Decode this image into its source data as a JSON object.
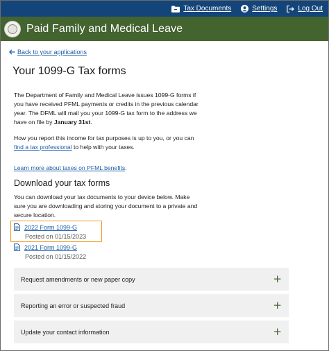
{
  "topbar": {
    "tax_documents": "Tax Documents",
    "settings": "Settings",
    "log_out": "Log Out",
    "background": "#14457a"
  },
  "brand": {
    "title": "Paid Family and Medical Leave",
    "background": "#43632f"
  },
  "nav": {
    "back": "Back to your applications"
  },
  "page": {
    "title": "Your 1099-G Tax forms",
    "intro_part1": "The Department of Family and Medical Leave issues 1099-G forms if you have received PFML payments or credits in the previous calendar year. The DFML will mail you your 1099-G tax form to the address we have on file by ",
    "intro_date": "January 31st",
    "intro_end": ".",
    "report_part1": "How you report this income for tax purposes is up to you, or you can ",
    "report_link": "find a tax professional",
    "report_part2": " to help with your taxes.",
    "learn_more": "Learn more about taxes on PFML benefits",
    "learn_more_end": "."
  },
  "download": {
    "title": "Download your tax forms",
    "description": "You can download your tax documents to your device below. Make sure you are downloading and storing your document to a private and secure location.",
    "forms": [
      {
        "label": "2022 Form 1099-G",
        "posted": "Posted on 01/15/2023"
      },
      {
        "label": "2021 Form 1099-G",
        "posted": "Posted on 01/15/2022"
      }
    ]
  },
  "accordions": [
    {
      "label": "Request amendments or new paper copy",
      "icon": "+"
    },
    {
      "label": "Reporting an error or suspected fraud",
      "icon": "+"
    },
    {
      "label": "Update your contact information",
      "icon": "+"
    }
  ],
  "colors": {
    "link": "#1a5ca8",
    "highlight": "#f0961e",
    "accordion_bg": "#f0f0f0",
    "accent_green": "#43632f"
  }
}
